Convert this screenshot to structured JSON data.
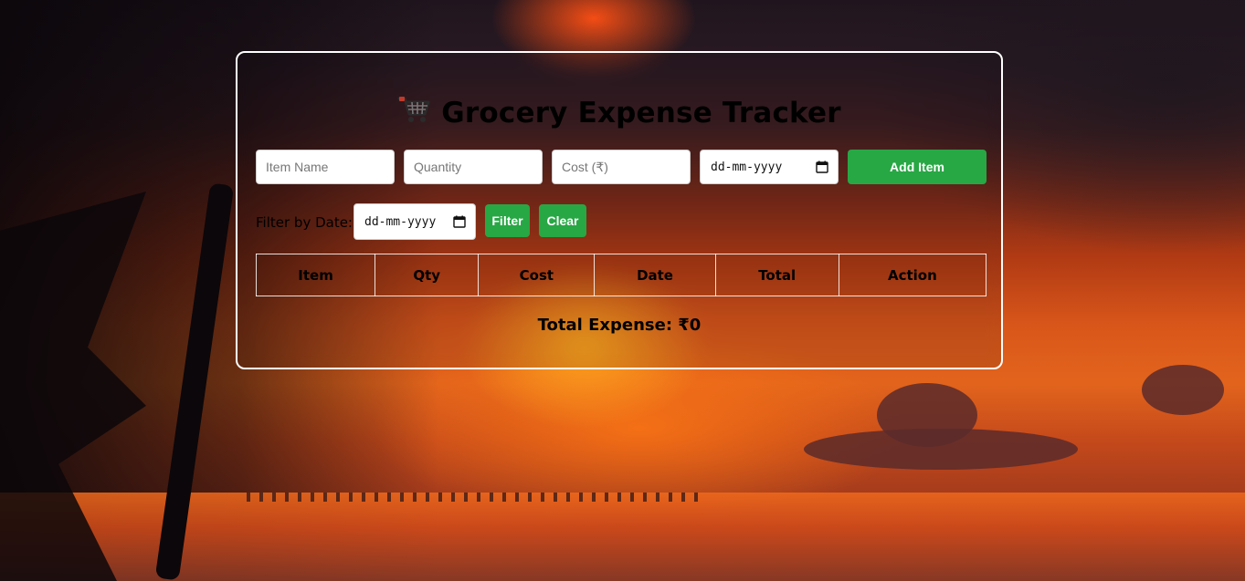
{
  "app": {
    "title": "Grocery Expense Tracker",
    "title_icon": "shopping-cart-icon"
  },
  "form": {
    "item_name_placeholder": "Item Name",
    "quantity_placeholder": "Quantity",
    "cost_placeholder": "Cost (₹)",
    "date_placeholder": "dd-mm-yyyy",
    "add_button_label": "Add Item"
  },
  "filter": {
    "label": "Filter by Date:",
    "date_placeholder": "dd-mm-yyyy",
    "filter_button_label": "Filter",
    "clear_button_label": "Clear"
  },
  "table": {
    "headers": [
      "Item",
      "Qty",
      "Cost",
      "Date",
      "Total",
      "Action"
    ]
  },
  "summary": {
    "total_label": "Total Expense: ₹0"
  },
  "colors": {
    "accent": "#28a745",
    "panel_border": "#ffffff"
  }
}
